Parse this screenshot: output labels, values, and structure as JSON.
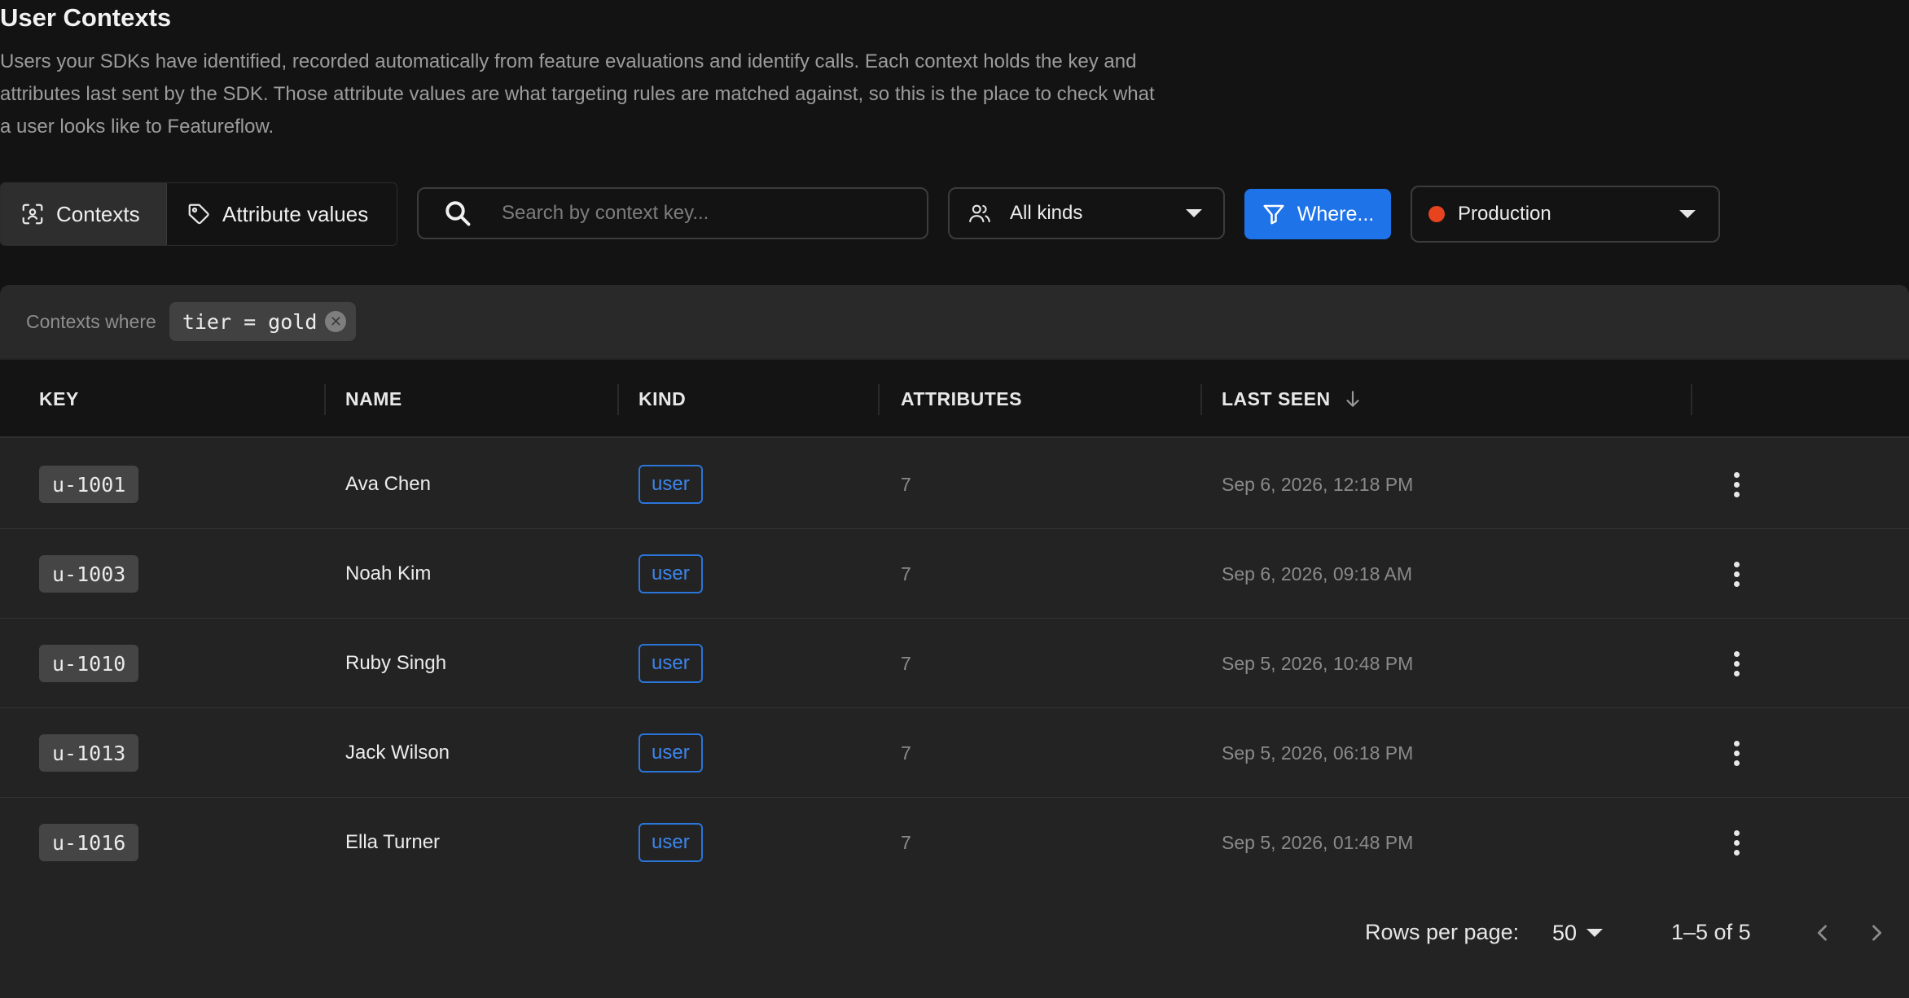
{
  "page": {
    "title": "User Contexts",
    "description": "Users your SDKs have identified, recorded automatically from feature evaluations and identify calls. Each context holds the key and attributes last sent by the SDK. Those attribute values are what targeting rules are matched against, so this is the place to check what a user looks like to Featureflow."
  },
  "toolbar": {
    "tabs": [
      {
        "label": "Contexts",
        "icon": "contexts-scan-icon",
        "active": true
      },
      {
        "label": "Attribute values",
        "icon": "tag-icon",
        "active": false
      }
    ],
    "search": {
      "placeholder": "Search by context key...",
      "value": "",
      "icon": "search-icon"
    },
    "kind_filter": {
      "value": "All kinds",
      "icon": "users-icon"
    },
    "where_button": {
      "label": "Where...",
      "icon": "filter-funnel-icon"
    },
    "environment": {
      "value": "Production",
      "color": "#e8431f"
    }
  },
  "filter": {
    "label": "Contexts where",
    "chip": "tier = gold"
  },
  "table": {
    "columns": [
      "KEY",
      "NAME",
      "KIND",
      "ATTRIBUTES",
      "LAST SEEN"
    ],
    "sort": {
      "column": "LAST SEEN",
      "direction": "descending"
    },
    "rows": [
      {
        "key": "u-1001",
        "name": "Ava Chen",
        "kind": "user",
        "attributes": "7",
        "last_seen": "Sep 6, 2026, 12:18 PM"
      },
      {
        "key": "u-1003",
        "name": "Noah Kim",
        "kind": "user",
        "attributes": "7",
        "last_seen": "Sep 6, 2026, 09:18 AM"
      },
      {
        "key": "u-1010",
        "name": "Ruby Singh",
        "kind": "user",
        "attributes": "7",
        "last_seen": "Sep 5, 2026, 10:48 PM"
      },
      {
        "key": "u-1013",
        "name": "Jack Wilson",
        "kind": "user",
        "attributes": "7",
        "last_seen": "Sep 5, 2026, 06:18 PM"
      },
      {
        "key": "u-1016",
        "name": "Ella Turner",
        "kind": "user",
        "attributes": "7",
        "last_seen": "Sep 5, 2026, 01:48 PM"
      }
    ]
  },
  "pagination": {
    "rows_per_page_label": "Rows per page:",
    "rows_per_page": "50",
    "range": "1–5 of 5"
  },
  "colors": {
    "accent": "#1f73e8",
    "kind_badge": "#3d86ec",
    "environment_dot": "#e8431f",
    "background": "#131313",
    "panel": "#232323"
  }
}
